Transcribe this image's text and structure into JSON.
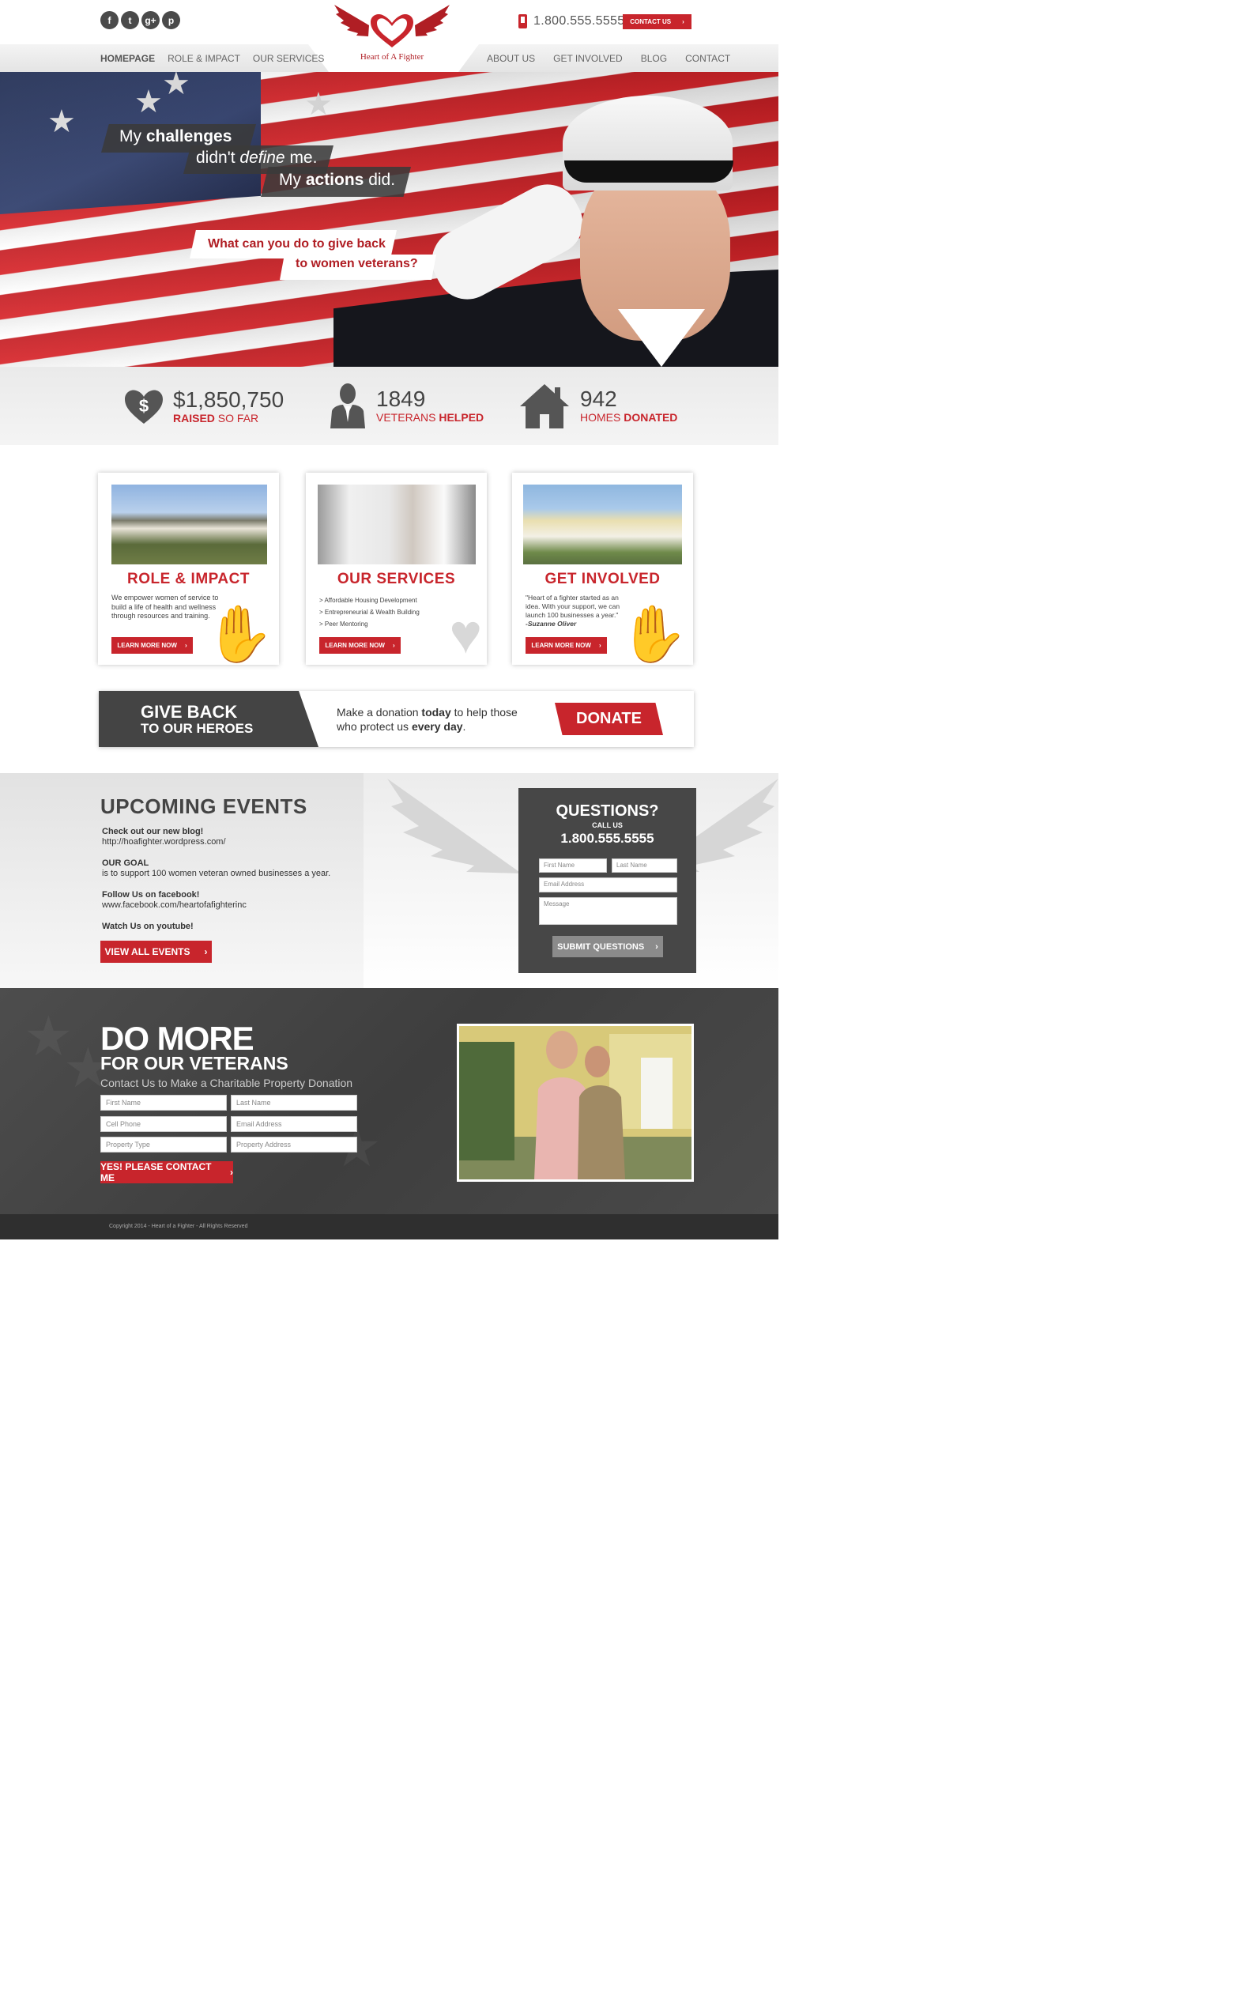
{
  "header": {
    "social": [
      {
        "icon": "facebook-icon",
        "glyph": "f"
      },
      {
        "icon": "twitter-icon",
        "glyph": "t"
      },
      {
        "icon": "google-plus-icon",
        "glyph": "g+"
      },
      {
        "icon": "pinterest-icon",
        "glyph": "p"
      }
    ],
    "phone": "1.800.555.5555",
    "contact_label": "CONTACT US",
    "logo_text": "Heart of A Fighter"
  },
  "nav": {
    "left": [
      "HOMEPAGE",
      "ROLE & IMPACT",
      "OUR SERVICES"
    ],
    "right": [
      "ABOUT US",
      "GET INVOLVED",
      "BLOG",
      "CONTACT"
    ],
    "active": "HOMEPAGE"
  },
  "hero": {
    "line1_a": "My ",
    "line1_b": "challenges",
    "line2_a": "didn't ",
    "line2_b": "define",
    "line2_c": " me.",
    "line3_a": "My ",
    "line3_b": "actions",
    "line3_c": " did.",
    "question1": "What can you do to give back",
    "question2": "to women veterans?"
  },
  "stats": [
    {
      "value": "$1,850,750",
      "label_bold": "RAISED",
      "label_rest": " SO FAR",
      "icon": "heart-dollar-icon"
    },
    {
      "value": "1849",
      "label_rest": "VETERANS ",
      "label_bold": "HELPED",
      "icon": "veteran-icon"
    },
    {
      "value": "942",
      "label_rest": "HOMES ",
      "label_bold": "DONATED",
      "icon": "house-icon"
    }
  ],
  "cards": [
    {
      "title": "ROLE & IMPACT",
      "text": "We empower women of service to build a life of health and wellness through resources and training.",
      "button": "LEARN MORE NOW"
    },
    {
      "title": "OUR SERVICES",
      "items": [
        "> Affordable Housing Development",
        "> Entrepreneurial & Wealth Building",
        "> Peer Mentoring"
      ],
      "button": "LEARN MORE NOW"
    },
    {
      "title": "GET INVOLVED",
      "quote": "\"Heart of a fighter started as an idea. With your support, we can launch 100 businesses a year.\"",
      "author": "-Suzanne Oliver",
      "button": "LEARN MORE NOW"
    }
  ],
  "giveback": {
    "title1": "GIVE BACK",
    "title2": "TO OUR HEROES",
    "text_a": "Make a donation ",
    "text_b": "today",
    "text_c": " to help those who protect us ",
    "text_d": "every day",
    "text_e": ".",
    "donate": "DONATE"
  },
  "events": {
    "title": "UPCOMING EVENTS",
    "blocks": [
      {
        "head": "Check out our new blog!",
        "body": "http://hoafighter.wordpress.com/"
      },
      {
        "head": "OUR GOAL",
        "body": "is to support 100 women veteran owned businesses a year."
      },
      {
        "head": "Follow Us on facebook!",
        "body": "www.facebook.com/heartofafighterinc"
      },
      {
        "head": "Watch Us on youtube!",
        "body": ""
      }
    ],
    "button": "VIEW ALL EVENTS"
  },
  "questions": {
    "title": "QUESTIONS?",
    "call": "CALL US",
    "phone": "1.800.555.5555",
    "first": "First Name",
    "last": "Last Name",
    "email": "Email Address",
    "message": "Message",
    "submit": "SUBMIT QUESTIONS"
  },
  "domore": {
    "title1": "DO MORE",
    "title2": "FOR OUR VETERANS",
    "subtitle": "Contact Us to Make a Charitable Property Donation",
    "fields": [
      "First Name",
      "Last Name",
      "Cell Phone",
      "Email Address",
      "Property Type",
      "Property Address"
    ],
    "button": "YES! PLEASE CONTACT ME"
  },
  "footer": {
    "copyright": "Copyright 2014 - Heart of a Fighter - All Rights Reserved"
  },
  "colors": {
    "accent": "#c8252c",
    "dark": "#444444"
  }
}
